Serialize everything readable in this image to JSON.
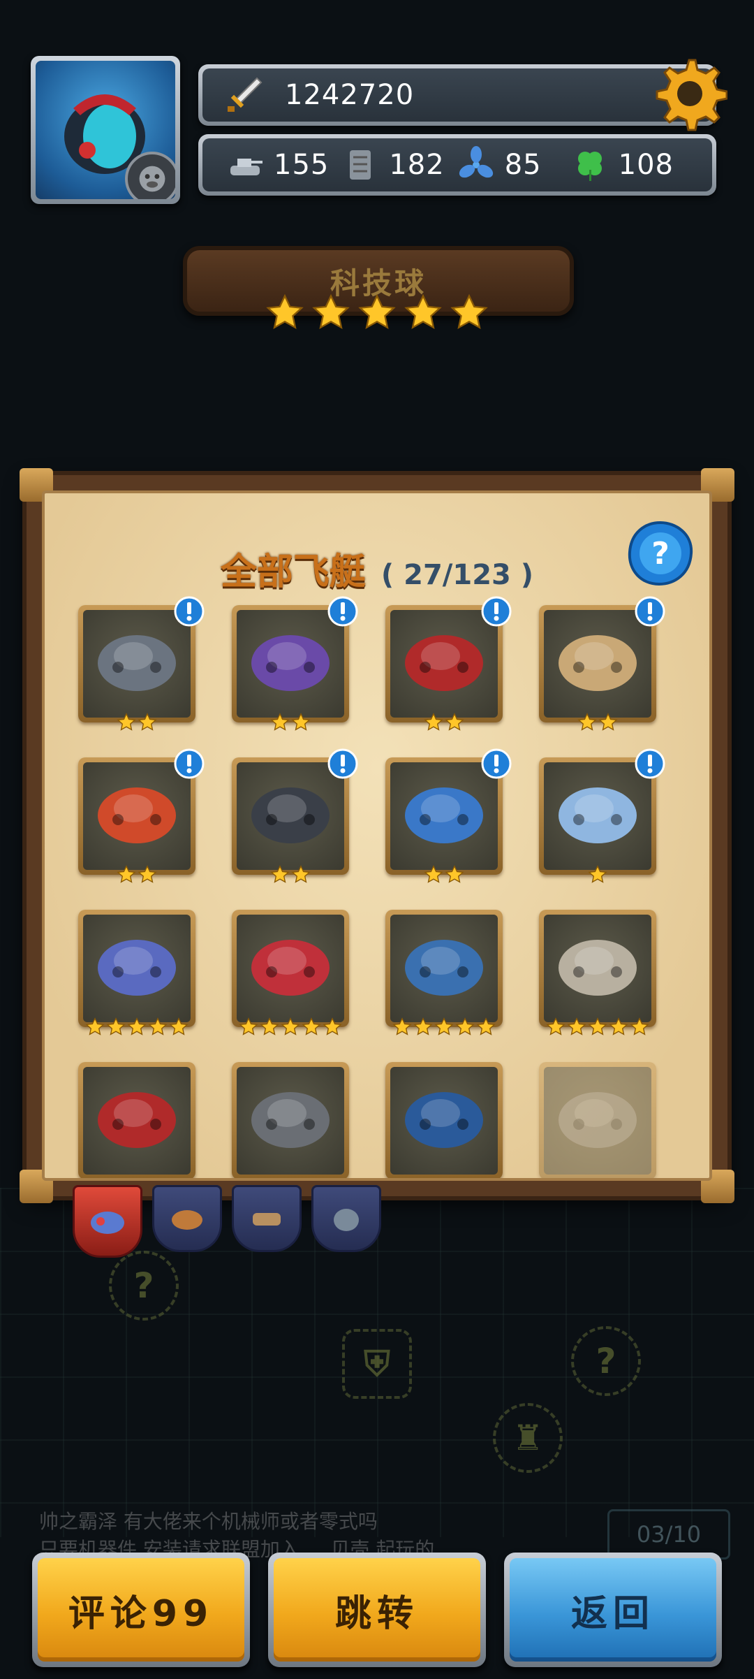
{
  "header": {
    "power": "1242720",
    "resources": [
      {
        "icon": "tank-icon",
        "value": "155"
      },
      {
        "icon": "armor-plate-icon",
        "value": "182"
      },
      {
        "icon": "fan-icon",
        "value": "85"
      },
      {
        "icon": "clover-icon",
        "value": "108"
      }
    ]
  },
  "selected_ship": {
    "name": "科技球",
    "stars": 5
  },
  "collection": {
    "title": "全部飞艇",
    "count": "( 27/123 )",
    "ships": [
      {
        "name": "ship-1",
        "stars": 2,
        "is_new": true,
        "color": "#6b7480",
        "locked": false
      },
      {
        "name": "ship-2",
        "stars": 2,
        "is_new": true,
        "color": "#6a4aa8",
        "locked": false
      },
      {
        "name": "ship-3",
        "stars": 2,
        "is_new": true,
        "color": "#b02a2a",
        "locked": false
      },
      {
        "name": "ship-4",
        "stars": 2,
        "is_new": true,
        "color": "#c9a876",
        "locked": false
      },
      {
        "name": "ship-5",
        "stars": 2,
        "is_new": true,
        "color": "#d04a2a",
        "locked": false
      },
      {
        "name": "ship-6",
        "stars": 2,
        "is_new": true,
        "color": "#3a3f48",
        "locked": false
      },
      {
        "name": "ship-7",
        "stars": 2,
        "is_new": true,
        "color": "#3a78c8",
        "locked": false
      },
      {
        "name": "ship-8",
        "stars": 1,
        "is_new": true,
        "color": "#8fb6e0",
        "locked": false
      },
      {
        "name": "ship-9",
        "stars": 5,
        "is_new": false,
        "color": "#5a6ac0",
        "locked": false
      },
      {
        "name": "ship-10",
        "stars": 5,
        "is_new": false,
        "color": "#c0303a",
        "locked": false
      },
      {
        "name": "ship-11",
        "stars": 5,
        "is_new": false,
        "color": "#3a70b0",
        "locked": false
      },
      {
        "name": "ship-12",
        "stars": 5,
        "is_new": false,
        "color": "#b8b0a0",
        "locked": false
      },
      {
        "name": "ship-13",
        "stars": 0,
        "is_new": false,
        "color": "#b02a2a",
        "locked": false
      },
      {
        "name": "ship-14",
        "stars": 0,
        "is_new": false,
        "color": "#6a6e74",
        "locked": false
      },
      {
        "name": "ship-15",
        "stars": 0,
        "is_new": false,
        "color": "#2a5a9a",
        "locked": false
      },
      {
        "name": "ship-16",
        "stars": 0,
        "is_new": false,
        "color": "#7a7a7a",
        "locked": true
      }
    ]
  },
  "chat": {
    "line1": "帅之霸泽  有大佬来个机械师或者零式吗",
    "line2": "只要机器件  安装请求联盟加入 ... 贝壳  起玩的"
  },
  "page_counter": "03/10",
  "buttons": {
    "comment": "评论99",
    "jump": "跳转",
    "back": "返回"
  },
  "colors": {
    "gold": "#f1a81c",
    "blue": "#3a96d8",
    "panel": "#e4c996"
  }
}
